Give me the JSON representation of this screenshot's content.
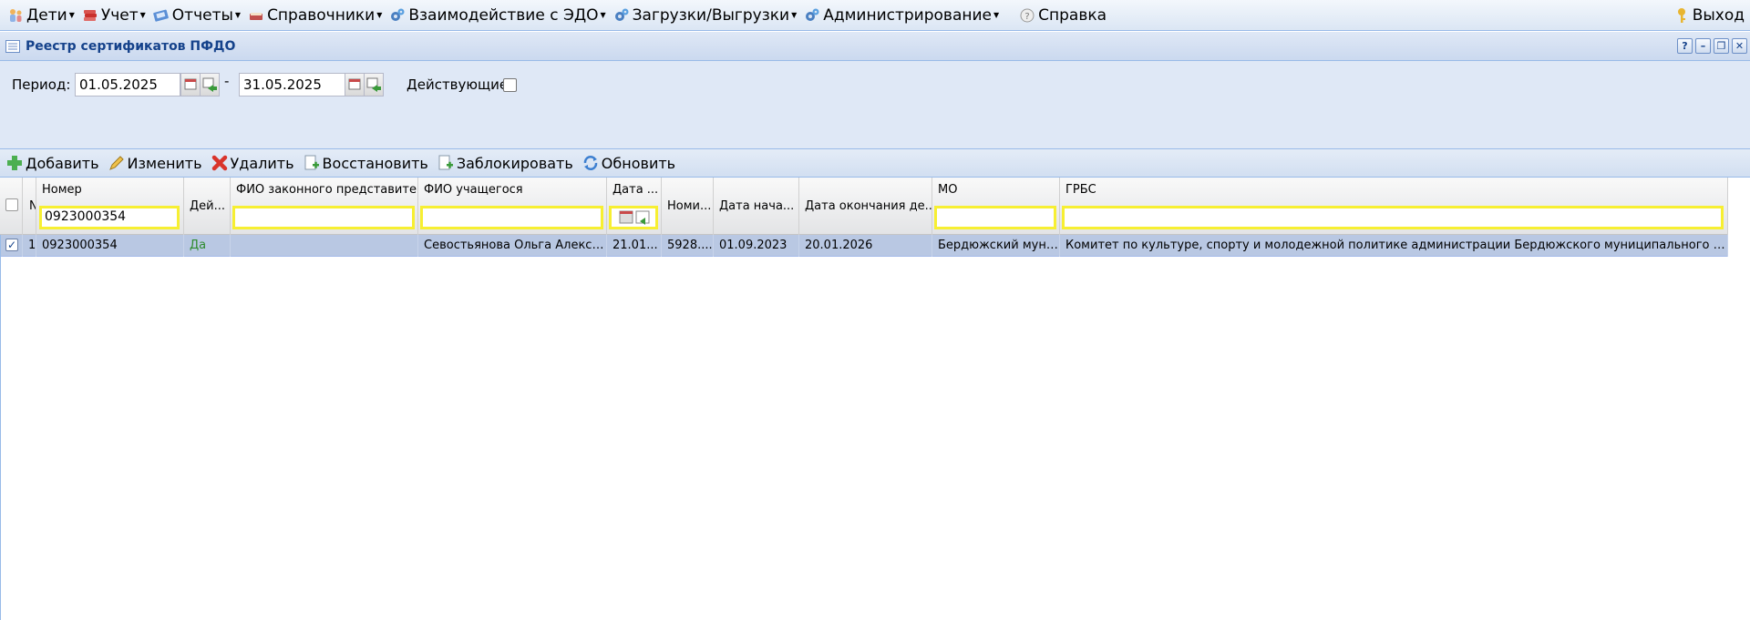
{
  "menu": {
    "items": [
      {
        "label": "Дети",
        "icon": "children-icon",
        "dropdown": true
      },
      {
        "label": "Учет",
        "icon": "books-icon",
        "dropdown": true
      },
      {
        "label": "Отчеты",
        "icon": "reports-icon",
        "dropdown": true
      },
      {
        "label": "Справочники",
        "icon": "reference-book-icon",
        "dropdown": true
      },
      {
        "label": "Взаимодействие с ЭДО",
        "icon": "gears-icon",
        "dropdown": true
      },
      {
        "label": "Загрузки/Выгрузки",
        "icon": "gears-icon",
        "dropdown": true
      },
      {
        "label": "Администрирование",
        "icon": "gears-icon",
        "dropdown": true
      },
      {
        "label": "Справка",
        "icon": "help-icon",
        "dropdown": false
      }
    ],
    "exit_label": "Выход"
  },
  "panel": {
    "title": "Реестр сертификатов ПФДО"
  },
  "filters": {
    "period_label": "Период:",
    "date_from": "01.05.2025",
    "separator": "-",
    "date_to": "31.05.2025",
    "active_label": "Действующие:",
    "active_checked": false
  },
  "toolbar": {
    "add": "Добавить",
    "edit": "Изменить",
    "delete": "Удалить",
    "restore": "Восстановить",
    "block": "Заблокировать",
    "refresh": "Обновить"
  },
  "grid": {
    "columns": {
      "num": "N",
      "number": "Номер",
      "active": "Дей...",
      "guardian": "ФИО законного представите...",
      "student": "ФИО учащегося",
      "date": "Дата ...",
      "nominal": "Номи...",
      "start": "Дата нача...",
      "end": "Дата окончания де...",
      "mo": "МО",
      "grbs": "ГРБС"
    },
    "filter_number_value": "0923000354",
    "rows": [
      {
        "checked": true,
        "num": "1",
        "number": "0923000354",
        "active": "Да",
        "guardian": "",
        "student": "Севостьянова Ольга Алекса...",
        "date": "21.01...",
        "nominal": "5928....",
        "start": "01.09.2023",
        "end": "20.01.2026",
        "mo": "Бердюжский муни...",
        "grbs": "Комитет по культуре, спорту и молодежной политике администрации Бердюжского муниципального района,К..."
      }
    ]
  },
  "colors": {
    "accent": "#15428b",
    "selected_row": "#b9c8e3",
    "active_yes": "#2e8b2e",
    "filter_border": "#f7ef32"
  }
}
